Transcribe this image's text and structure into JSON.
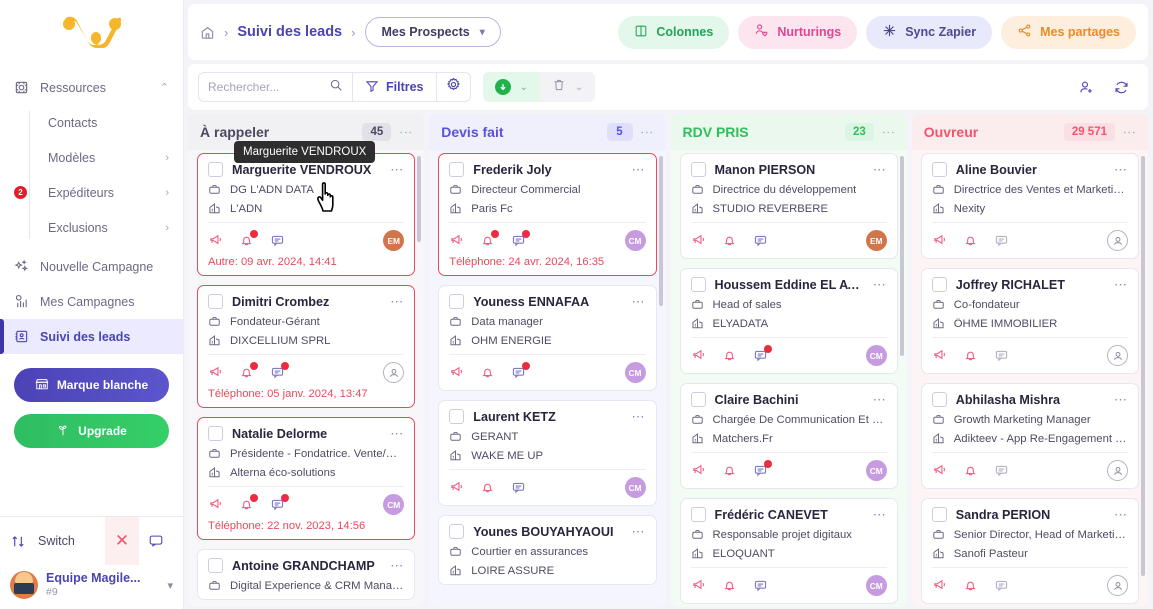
{
  "sidebar": {
    "logo_name": "magileads-logo",
    "nav": [
      {
        "label": "Ressources",
        "icon": "resources-icon",
        "chevron": "⌃",
        "expanded": true
      }
    ],
    "sub_items": [
      {
        "label": "Contacts",
        "chevron": "",
        "badge": ""
      },
      {
        "label": "Modèles",
        "chevron": "›",
        "badge": ""
      },
      {
        "label": "Expéditeurs",
        "chevron": "›",
        "badge": "2"
      },
      {
        "label": "Exclusions",
        "chevron": "›",
        "badge": ""
      }
    ],
    "nav2": [
      {
        "label": "Nouvelle Campagne",
        "icon": "sparkle-icon",
        "active": false
      },
      {
        "label": "Mes Campagnes",
        "icon": "chart-icon",
        "active": false
      },
      {
        "label": "Suivi des leads",
        "icon": "contact-book-icon",
        "active": true
      }
    ],
    "buttons": {
      "marque_blanche": "Marque blanche",
      "upgrade": "Upgrade"
    },
    "switch_label": "Switch",
    "team_name": "Equipe Magile...",
    "team_id": "#9"
  },
  "topbar": {
    "home_icon": "home-icon",
    "breadcrumb_sep": "›",
    "breadcrumb_title": "Suivi des leads",
    "select_label": "Mes Prospects",
    "select_chevron": "⌄",
    "actions": [
      {
        "label": "Colonnes",
        "icon": "columns-icon",
        "theme": "chip-green"
      },
      {
        "label": "Nurturings",
        "icon": "nurturing-icon",
        "theme": "chip-pink"
      },
      {
        "label": "Sync Zapier",
        "icon": "zapier-icon",
        "theme": "chip-blue"
      },
      {
        "label": "Mes partages",
        "icon": "share-icon",
        "theme": "chip-orange"
      }
    ]
  },
  "toolbar": {
    "search_placeholder": "Rechercher...",
    "search_value": "",
    "filters_label": "Filtres",
    "gear_icon": "gear-icon",
    "download_icon": "download-icon",
    "trash_icon": "trash-icon",
    "chevron": "⌄",
    "add_user_icon": "add-user-icon",
    "refresh_icon": "refresh-icon"
  },
  "tooltip": "Marguerite VENDROUX",
  "board": {
    "columns": [
      {
        "title": "À rappeler",
        "count": "45",
        "theme": "c1",
        "cards": [
          {
            "name": "Marguerite VENDROUX",
            "role": "DG L'ADN DATA",
            "company": "L'ADN",
            "date": "Autre: 09 avr. 2024, 14:41",
            "avatar": "EM",
            "avatar_class": "av-EM",
            "highlight": true,
            "badges": {
              "megaphone": false,
              "bell": true,
              "comment": false
            },
            "comment_active": true
          },
          {
            "name": "Dimitri Crombez",
            "role": "Fondateur-Gérant",
            "company": "DIXCELLIUM SPRL",
            "date": "Téléphone: 05 janv. 2024, 13:47",
            "avatar": "",
            "avatar_class": "av-none",
            "highlight": true,
            "badges": {
              "megaphone": false,
              "bell": true,
              "comment": true
            },
            "comment_active": true
          },
          {
            "name": "Natalie Delorme",
            "role": "Présidente - Fondatrice. Vente/Marke...",
            "company": "Alterna éco-solutions",
            "date": "Téléphone: 22 nov. 2023, 14:56",
            "avatar": "CM",
            "avatar_class": "av-CM",
            "highlight": true,
            "badges": {
              "megaphone": false,
              "bell": true,
              "comment": true
            },
            "comment_active": true
          },
          {
            "name": "Antoine GRANDCHAMP",
            "role": "Digital Experience & CRM Manager",
            "company": "",
            "date": "",
            "avatar": "",
            "avatar_class": "av-none",
            "highlight": false,
            "clipped": true,
            "badges": {
              "megaphone": false,
              "bell": false,
              "comment": false
            },
            "comment_active": true
          }
        ]
      },
      {
        "title": "Devis fait",
        "count": "5",
        "theme": "c2",
        "cards": [
          {
            "name": "Frederik Joly",
            "role": "Directeur Commercial",
            "company": "Paris Fc",
            "date": "Téléphone: 24 avr. 2024, 16:35",
            "avatar": "CM",
            "avatar_class": "av-CM",
            "highlight": true,
            "badges": {
              "megaphone": false,
              "bell": true,
              "comment": true
            },
            "comment_active": true
          },
          {
            "name": "Youness ENNAFAA",
            "role": "Data manager",
            "company": "OHM ENERGIE",
            "date": "",
            "avatar": "CM",
            "avatar_class": "av-CM",
            "highlight": false,
            "badges": {
              "megaphone": false,
              "bell": false,
              "comment": true
            },
            "comment_active": true
          },
          {
            "name": "Laurent KETZ",
            "role": "GERANT",
            "company": "WAKE ME UP",
            "date": "",
            "avatar": "CM",
            "avatar_class": "av-CM",
            "highlight": false,
            "badges": {
              "megaphone": false,
              "bell": false,
              "comment": false
            },
            "comment_active": true
          },
          {
            "name": "Younes BOUYAHYAOUI",
            "role": "Courtier en assurances",
            "company": "LOIRE ASSURE",
            "date": "",
            "avatar": "CM",
            "avatar_class": "av-CM",
            "highlight": false,
            "clipped": true,
            "badges": {
              "megaphone": false,
              "bell": false,
              "comment": false
            },
            "comment_active": true
          }
        ]
      },
      {
        "title": "RDV PRIS",
        "count": "23",
        "theme": "c3",
        "cards": [
          {
            "name": "Manon PIERSON",
            "role": "Directrice du développement",
            "company": "STUDIO REVERBERE",
            "date": "",
            "avatar": "EM",
            "avatar_class": "av-EM",
            "highlight": false,
            "badges": {
              "megaphone": false,
              "bell": false,
              "comment": false
            },
            "comment_active": true
          },
          {
            "name": "Houssem Eddine EL AYADI",
            "role": "Head of sales",
            "company": "ELYADATA",
            "date": "",
            "avatar": "CM",
            "avatar_class": "av-CM",
            "highlight": false,
            "badges": {
              "megaphone": false,
              "bell": false,
              "comment": true
            },
            "comment_active": true
          },
          {
            "name": "Claire Bachini",
            "role": "Chargée De Communication Et Rédact...",
            "company": "Matchers.Fr",
            "date": "",
            "avatar": "CM",
            "avatar_class": "av-CM",
            "highlight": false,
            "badges": {
              "megaphone": false,
              "bell": false,
              "comment": true
            },
            "comment_active": true
          },
          {
            "name": "Frédéric CANEVET",
            "role": "Responsable projet digitaux",
            "company": "ELOQUANT",
            "date": "",
            "avatar": "CM",
            "avatar_class": "av-CM",
            "highlight": false,
            "badges": {
              "megaphone": false,
              "bell": false,
              "comment": false
            },
            "comment_active": true
          }
        ]
      },
      {
        "title": "Ouvreur",
        "count": "29 571",
        "theme": "c4",
        "cards": [
          {
            "name": "Aline Bouvier",
            "role": "Directrice des Ventes et Marketing ré...",
            "company": "Nexity",
            "date": "",
            "avatar": "",
            "avatar_class": "av-none",
            "highlight": false,
            "badges": {
              "megaphone": false,
              "bell": false,
              "comment": false
            },
            "comment_active": false
          },
          {
            "name": "Joffrey RICHALET",
            "role": "Co-fondateur",
            "company": "ÔHME IMMOBILIER",
            "date": "",
            "avatar": "",
            "avatar_class": "av-none",
            "highlight": false,
            "badges": {
              "megaphone": false,
              "bell": false,
              "comment": false
            },
            "comment_active": false
          },
          {
            "name": "Abhilasha Mishra",
            "role": "Growth Marketing Manager",
            "company": "Adikteev - App Re-Engagement Platfor...",
            "date": "",
            "avatar": "",
            "avatar_class": "av-none",
            "highlight": false,
            "badges": {
              "megaphone": false,
              "bell": false,
              "comment": false
            },
            "comment_active": false
          },
          {
            "name": "Sandra PERION",
            "role": "Senior Director, Head of Marketing, Fl...",
            "company": "Sanofi Pasteur",
            "date": "",
            "avatar": "",
            "avatar_class": "av-none",
            "highlight": false,
            "badges": {
              "megaphone": false,
              "bell": false,
              "comment": false
            },
            "comment_active": false
          }
        ]
      }
    ]
  }
}
